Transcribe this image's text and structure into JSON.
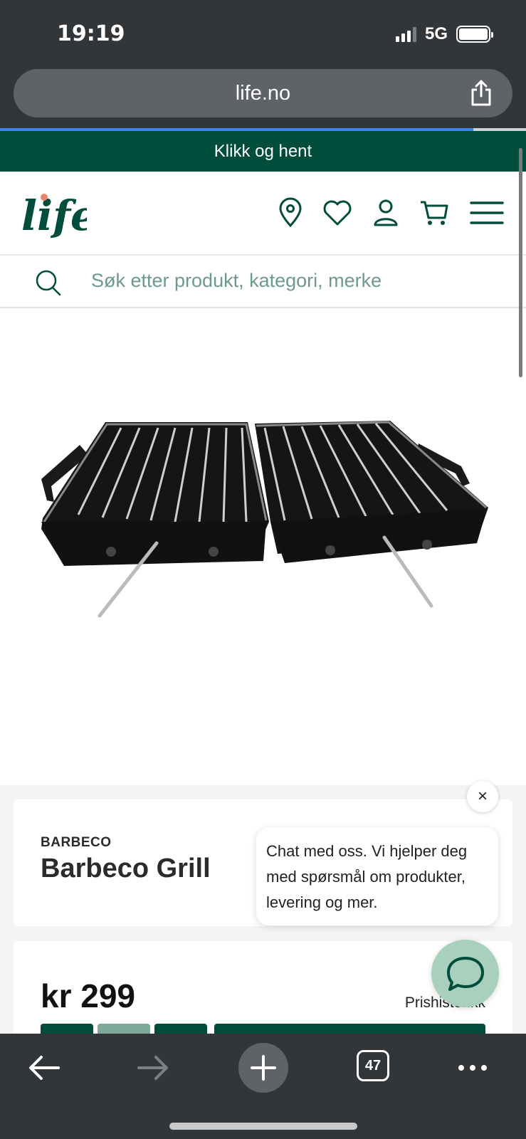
{
  "status_bar": {
    "time": "19:19",
    "network": "5G"
  },
  "browser": {
    "url": "life.no",
    "open_tabs": "47"
  },
  "promo": {
    "text": "Klikk og hent"
  },
  "header": {
    "logo_text": "life"
  },
  "search": {
    "placeholder": "Søk etter produkt, kategori, merke"
  },
  "product": {
    "brand": "BARBECO",
    "name": "Barbeco Grill",
    "price": "kr 299",
    "price_history_label": "Prishistorikk"
  },
  "chat": {
    "message": "Chat med oss. Vi hjelper deg med spørsmål om produkter, levering og mer.",
    "close_label": "×"
  },
  "colors": {
    "brand_green": "#004d3c",
    "accent_green": "#a9cfbd",
    "browser_bg": "#323639"
  }
}
